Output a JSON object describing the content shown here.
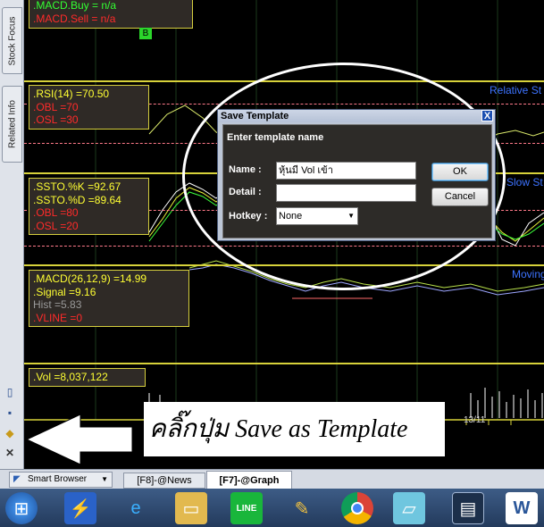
{
  "sidebar": {
    "tabs": [
      "Stock Focus",
      "Related Info"
    ]
  },
  "macd_top": {
    "buy": ".MACD.Buy   = n/a",
    "sell": ".MACD.Sell   = n/a",
    "marker": "B"
  },
  "rsi": {
    "line1": ".RSI(14)   =70.50",
    "line2": ".OBL   =70",
    "line3": ".OSL   =30",
    "side_label": "Relative St"
  },
  "ssto": {
    "line1": ".SSTO.%K   =92.67",
    "line2": ".SSTO.%D   =89.64",
    "line3": ".OBL   =80",
    "line4": ".OSL   =20",
    "side_label": "Slow St"
  },
  "macd": {
    "line1": ".MACD(26,12,9)   =14.99",
    "line2": ".Signal   =9.16",
    "line3": " Hist   =5.83",
    "line4": ".VLINE   =0",
    "side_label": "Moving"
  },
  "vol": {
    "line1": ".Vol   =8,037,122",
    "date_label": "13/11"
  },
  "dialog": {
    "title": "Save Template",
    "close": "X",
    "heading": "Enter template name",
    "name_label": "Name :",
    "name_value": "หุ้นมี Vol เข้า",
    "detail_label": "Detail :",
    "detail_value": "",
    "hotkey_label": "Hotkey :",
    "hotkey_value": "None",
    "ok": "OK",
    "cancel": "Cancel"
  },
  "annotation": "คลิ๊กปุ่ม Save as Template",
  "tabstrip": {
    "browser": "Smart Browser",
    "tabs": [
      "[F8]-@News",
      "[F7]-@Graph"
    ]
  },
  "taskbar": {
    "icons": [
      "windows-start-icon",
      "lightning-icon",
      "internet-explorer-icon",
      "folder-icon",
      "line-icon",
      "paint-icon",
      "chrome-icon",
      "notes-icon",
      "chart-app-icon",
      "word-icon"
    ]
  },
  "colors": {
    "panel_border": "#d7d23a",
    "dialog_bg": "#2d2b28",
    "taskbar": "#233a5c"
  }
}
